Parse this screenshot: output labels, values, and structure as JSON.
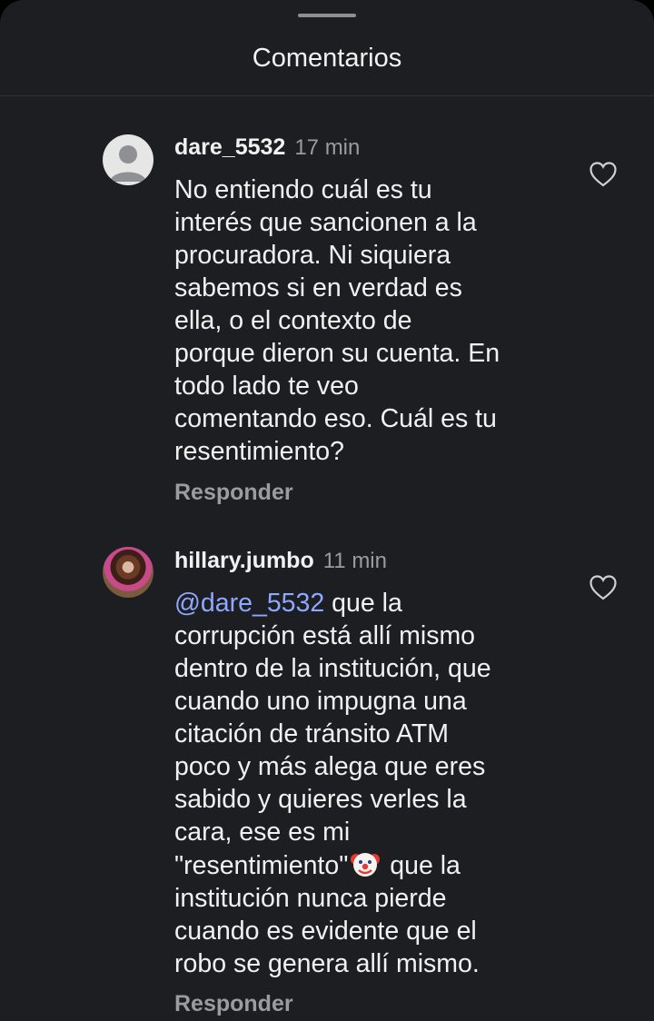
{
  "header": {
    "title": "Comentarios"
  },
  "comments": [
    {
      "username": "dare_5532",
      "time": "17 min",
      "text": "No entiendo cuál es tu\ninterés que sancionen a la\nprocuradora. Ni siquiera\nsabemos si en verdad es\nella, o el contexto de\nporque dieron su cuenta. En\ntodo lado te veo\ncomentando eso. Cuál es tu\nresentimiento?",
      "reply_label": "Responder",
      "avatar_icon": "default-profile-icon",
      "like_icon": "heart-outline-icon"
    },
    {
      "username": "hillary.jumbo",
      "time": "11 min",
      "mention": "@dare_5532",
      "text_part1": " que la\ncorrupción está allí mismo\ndentro de la institución, que\ncuando uno impugna una\ncitación de tránsito ATM\npoco y más alega que eres\nsabido y quieres verles la\ncara, ese es mi\n\"resentimiento\"",
      "emoji": "clown-face-emoji",
      "text_part2": " que la\ninstitución nunca pierde\ncuando es evidente que el\nrobo se genera allí mismo.",
      "reply_label": "Responder",
      "avatar_icon": "profile-photo",
      "like_icon": "heart-outline-icon"
    }
  ],
  "colors": {
    "background": "#1c1e21",
    "text": "#f1f1f1",
    "secondary_text": "#9a9c9f",
    "mention": "#8fa8ff"
  }
}
